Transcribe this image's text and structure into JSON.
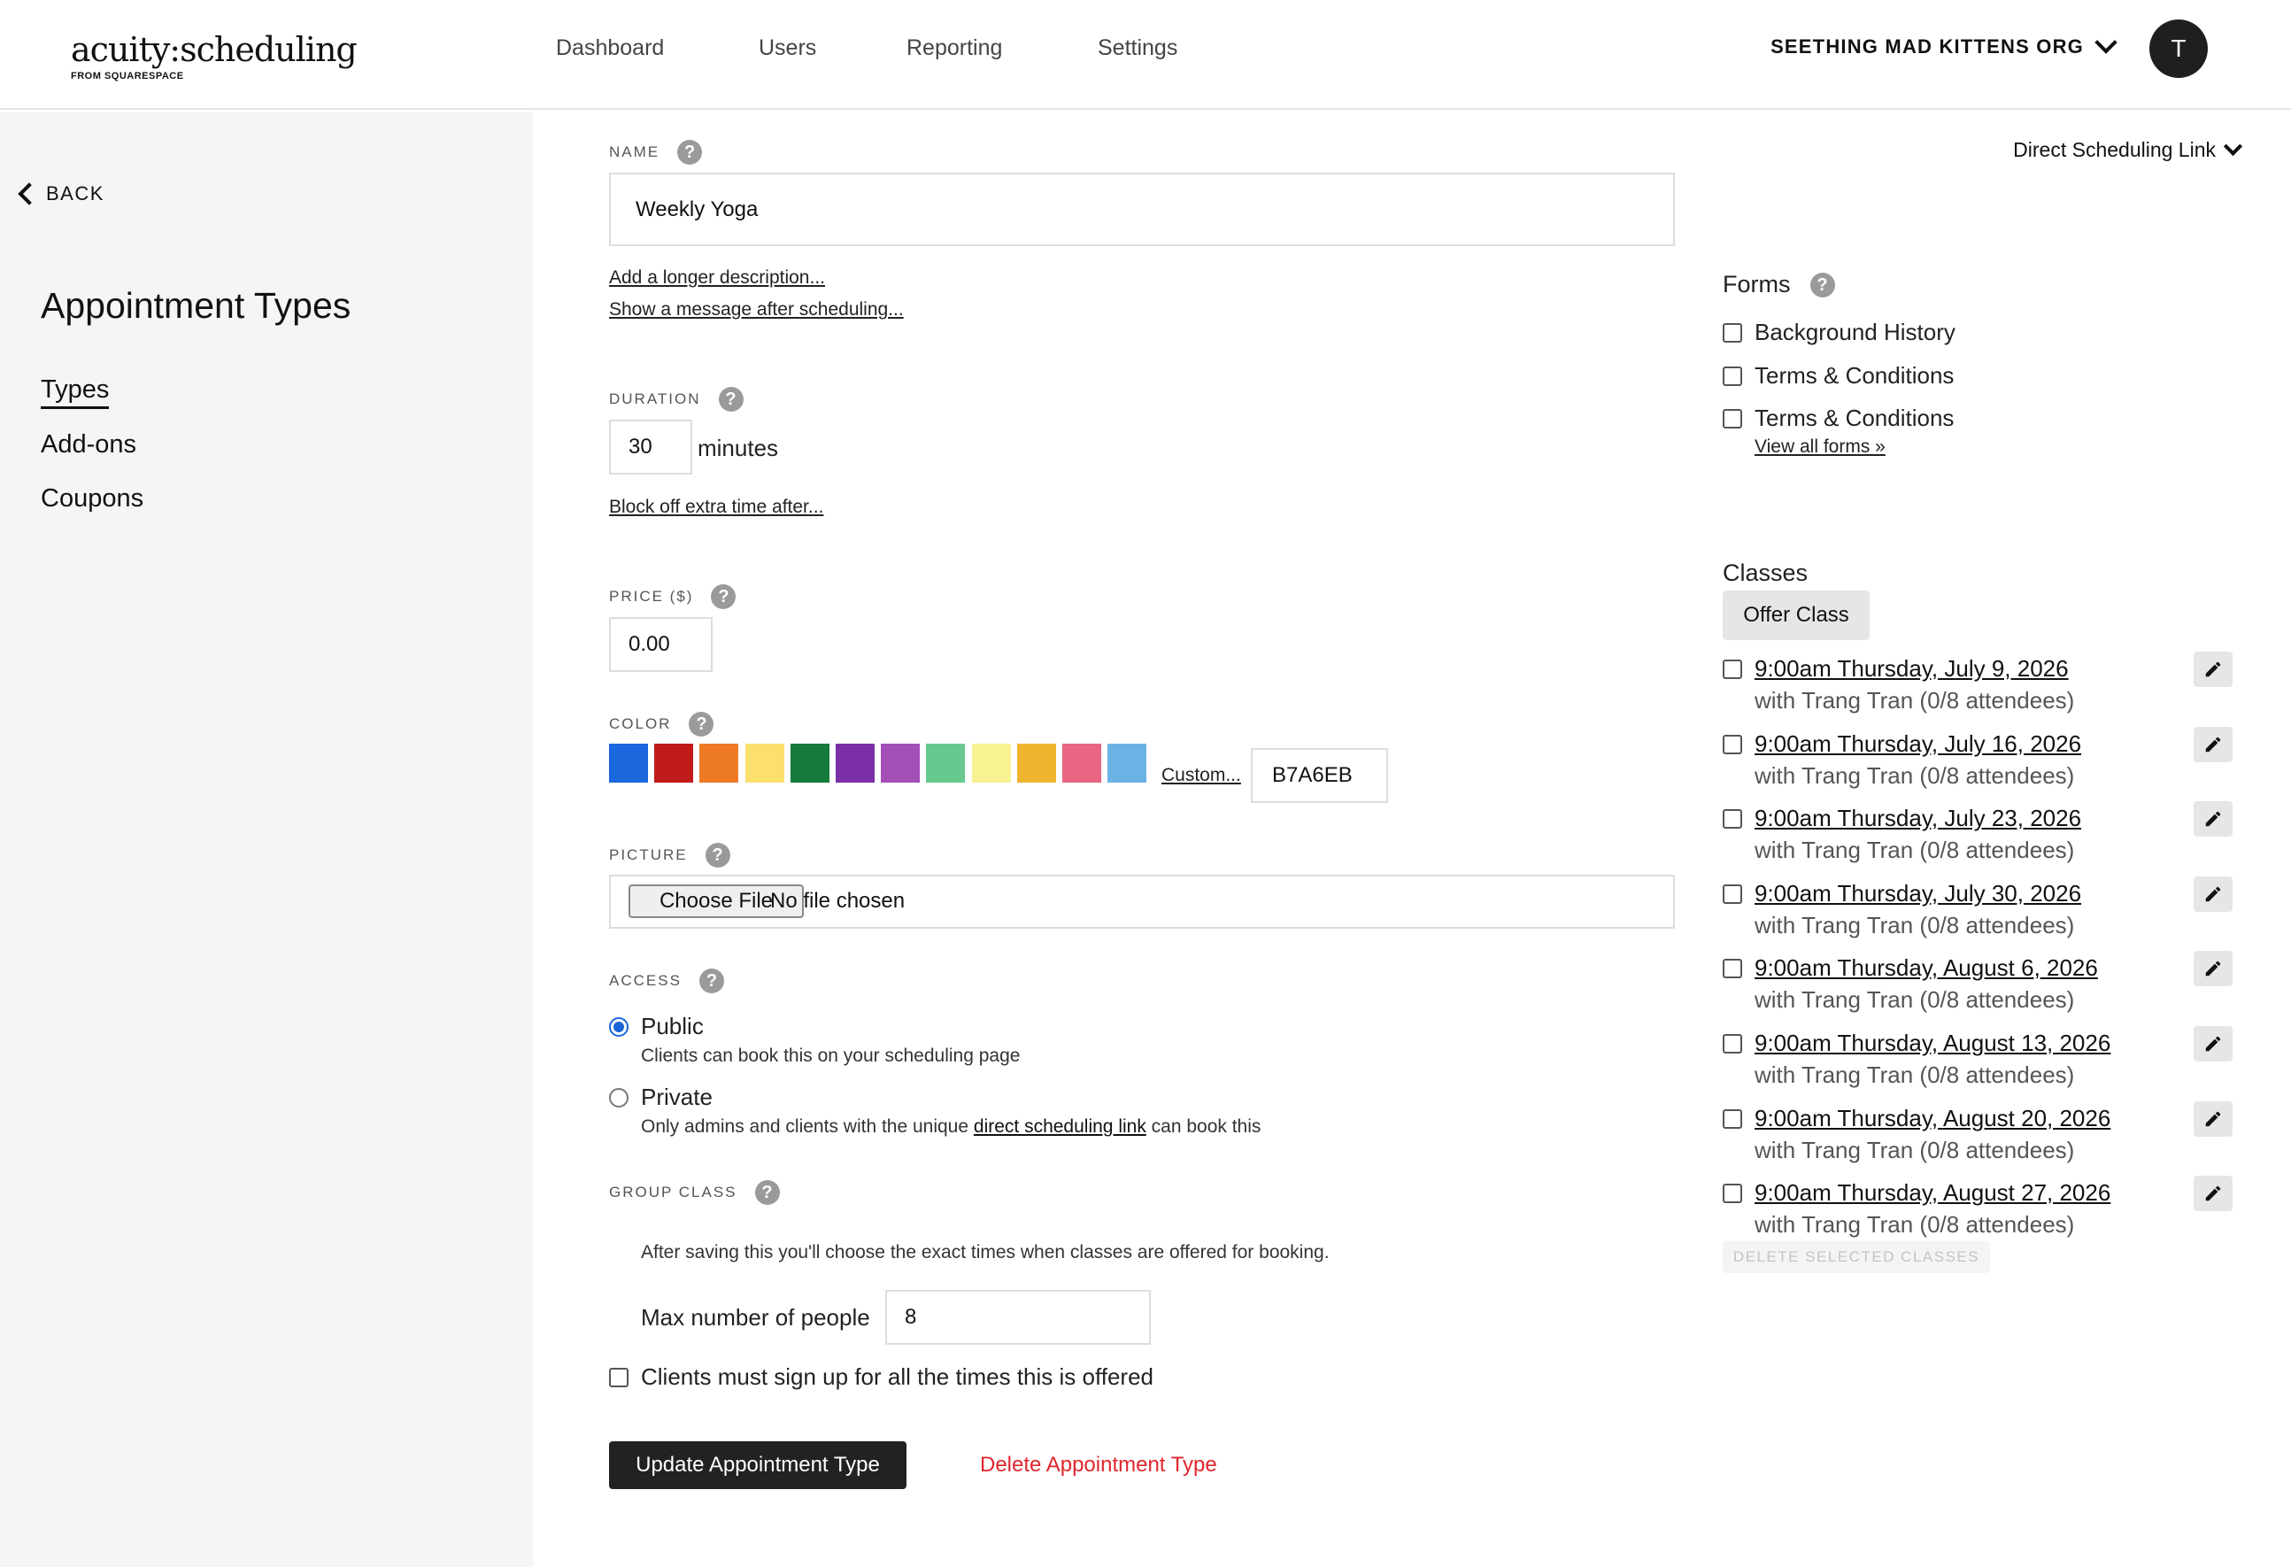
{
  "header": {
    "logo_main": "acuity:scheduling",
    "logo_sub": "FROM SQUARESPACE",
    "nav": [
      "Dashboard",
      "Users",
      "Reporting",
      "Settings"
    ],
    "org": "SEETHING MAD KITTENS ORG",
    "avatar_initial": "T"
  },
  "sidebar": {
    "back": "BACK",
    "title": "Appointment Types",
    "items": [
      "Types",
      "Add-ons",
      "Coupons"
    ]
  },
  "form": {
    "name_label": "NAME",
    "name_value": "Weekly Yoga",
    "longer_desc_link": "Add a longer description...",
    "message_link": "Show a message after scheduling...",
    "duration_label": "DURATION",
    "duration_value": "30",
    "duration_unit": "minutes",
    "block_off_link": "Block off extra time after...",
    "price_label": "PRICE ($)",
    "price_value": "0.00",
    "color_label": "COLOR",
    "colors": [
      "#1b67de",
      "#c01a1a",
      "#ee7a25",
      "#fbe06d",
      "#167a3a",
      "#7a2fa6",
      "#a24fb8",
      "#68c98f",
      "#f7f393",
      "#f0b52f",
      "#e86681",
      "#6cb3e5"
    ],
    "custom_link": "Custom...",
    "custom_value": "B7A6EB",
    "picture_label": "PICTURE",
    "choose_file": "Choose File",
    "no_file": "No file chosen",
    "access_label": "ACCESS",
    "public_label": "Public",
    "public_desc": "Clients can book this on your scheduling page",
    "private_label": "Private",
    "private_desc_pre": "Only admins and clients with the unique ",
    "private_desc_link": "direct scheduling link",
    "private_desc_post": " can book this",
    "group_label": "GROUP CLASS",
    "group_desc": "After saving this you'll choose the exact times when classes are offered for booking.",
    "max_people_label": "Max number of people",
    "max_people_value": "8",
    "signup_all_label": "Clients must sign up for all the times this is offered",
    "update_button": "Update Appointment Type",
    "delete_link": "Delete Appointment Type"
  },
  "right": {
    "direct_link": "Direct Scheduling Link",
    "forms_title": "Forms",
    "forms": [
      "Background History",
      "Terms & Conditions",
      "Terms & Conditions"
    ],
    "view_all_forms": "View all forms »",
    "classes_title": "Classes",
    "offer_class": "Offer Class",
    "classes": [
      {
        "date": "9:00am Thursday, July 9, 2026",
        "with": "with Trang Tran (0/8 attendees)"
      },
      {
        "date": "9:00am Thursday, July 16, 2026",
        "with": "with Trang Tran (0/8 attendees)"
      },
      {
        "date": "9:00am Thursday, July 23, 2026",
        "with": "with Trang Tran (0/8 attendees)"
      },
      {
        "date": "9:00am Thursday, July 30, 2026",
        "with": "with Trang Tran (0/8 attendees)"
      },
      {
        "date": "9:00am Thursday, August 6, 2026",
        "with": "with Trang Tran (0/8 attendees)"
      },
      {
        "date": "9:00am Thursday, August 13, 2026",
        "with": "with Trang Tran (0/8 attendees)"
      },
      {
        "date": "9:00am Thursday, August 20, 2026",
        "with": "with Trang Tran (0/8 attendees)"
      },
      {
        "date": "9:00am Thursday, August 27, 2026",
        "with": "with Trang Tran (0/8 attendees)"
      }
    ],
    "delete_selected": "DELETE SELECTED CLASSES"
  }
}
